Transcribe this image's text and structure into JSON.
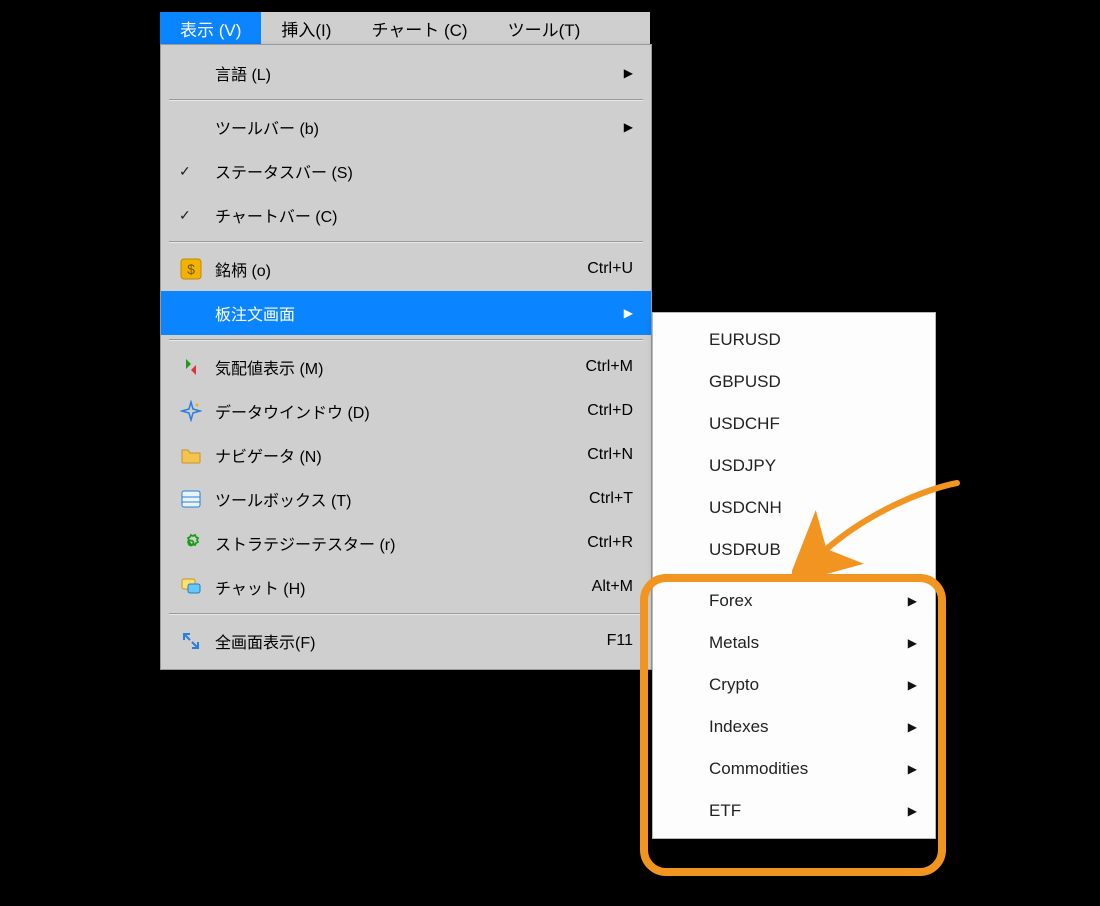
{
  "menubar": {
    "view": "表示 (V)",
    "insert": "挿入(I)",
    "chart": "チャート (C)",
    "tools": "ツール(T)"
  },
  "viewMenu": {
    "language": "言語 (L)",
    "toolbar": "ツールバー (b)",
    "statusbar": "ステータスバー (S)",
    "chartbar": "チャートバー (C)",
    "symbols": "銘柄 (o)",
    "symbols_sc": "Ctrl+U",
    "dom": "板注文画面",
    "marketwatch": "気配値表示 (M)",
    "marketwatch_sc": "Ctrl+M",
    "datawin": "データウインドウ (D)",
    "datawin_sc": "Ctrl+D",
    "navigator": "ナビゲータ (N)",
    "navigator_sc": "Ctrl+N",
    "toolbox": "ツールボックス (T)",
    "toolbox_sc": "Ctrl+T",
    "tester": "ストラテジーテスター (r)",
    "tester_sc": "Ctrl+R",
    "chat": "チャット (H)",
    "chat_sc": "Alt+M",
    "fullscreen": "全画面表示(F)",
    "fullscreen_sc": "F11"
  },
  "submenu": {
    "pairs": [
      "EURUSD",
      "GBPUSD",
      "USDCHF",
      "USDJPY",
      "USDCNH",
      "USDRUB"
    ],
    "groups": [
      "Forex",
      "Metals",
      "Crypto",
      "Indexes",
      "Commodities",
      "ETF"
    ]
  }
}
